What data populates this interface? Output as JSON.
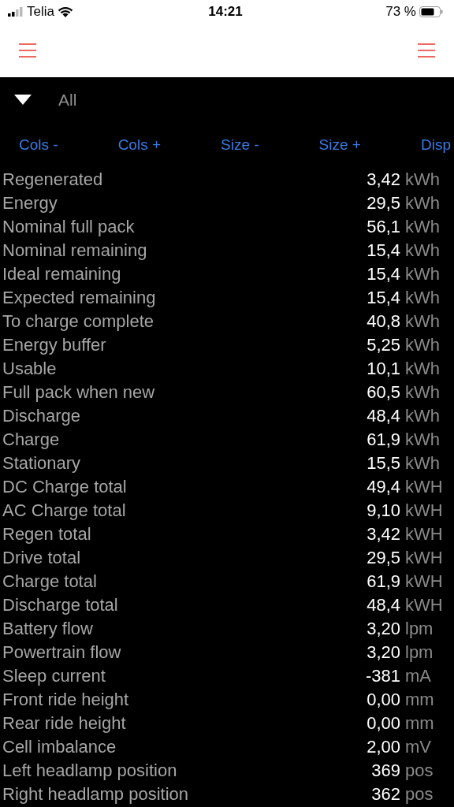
{
  "status_bar": {
    "carrier": "Telia",
    "time": "14:21",
    "battery": "73 %"
  },
  "filter": {
    "label": "All",
    "expanded": true
  },
  "toolbar": [
    "Cols -",
    "Cols +",
    "Size -",
    "Size +",
    "Disp"
  ],
  "rows": [
    {
      "label": "Regenerated",
      "value": "3,42",
      "unit": "kWh"
    },
    {
      "label": "Energy",
      "value": "29,5",
      "unit": "kWh"
    },
    {
      "label": "Nominal full pack",
      "value": "56,1",
      "unit": "kWh"
    },
    {
      "label": "Nominal remaining",
      "value": "15,4",
      "unit": "kWh"
    },
    {
      "label": "Ideal remaining",
      "value": "15,4",
      "unit": "kWh"
    },
    {
      "label": "Expected remaining",
      "value": "15,4",
      "unit": "kWh"
    },
    {
      "label": "To charge complete",
      "value": "40,8",
      "unit": "kWh"
    },
    {
      "label": "Energy buffer",
      "value": "5,25",
      "unit": "kWh"
    },
    {
      "label": "Usable",
      "value": "10,1",
      "unit": "kWh"
    },
    {
      "label": "Full pack when new",
      "value": "60,5",
      "unit": "kWh"
    },
    {
      "label": "Discharge",
      "value": "48,4",
      "unit": "kWh"
    },
    {
      "label": "Charge",
      "value": "61,9",
      "unit": "kWh"
    },
    {
      "label": "Stationary",
      "value": "15,5",
      "unit": "kWh"
    },
    {
      "label": "DC Charge total",
      "value": "49,4",
      "unit": "kWH"
    },
    {
      "label": "AC Charge total",
      "value": "9,10",
      "unit": "kWH"
    },
    {
      "label": "Regen total",
      "value": "3,42",
      "unit": "kWH"
    },
    {
      "label": "Drive total",
      "value": "29,5",
      "unit": "kWH"
    },
    {
      "label": "Charge total",
      "value": "61,9",
      "unit": "kWH"
    },
    {
      "label": "Discharge total",
      "value": "48,4",
      "unit": "kWH"
    },
    {
      "label": "Battery flow",
      "value": "3,20",
      "unit": "lpm"
    },
    {
      "label": "Powertrain flow",
      "value": "3,20",
      "unit": "lpm"
    },
    {
      "label": "Sleep current",
      "value": "-381",
      "unit": "mA"
    },
    {
      "label": "Front ride height",
      "value": "0,00",
      "unit": "mm"
    },
    {
      "label": "Rear ride height",
      "value": "0,00",
      "unit": "mm"
    },
    {
      "label": "Cell imbalance",
      "value": "2,00",
      "unit": "mV"
    },
    {
      "label": "Left headlamp position",
      "value": "369",
      "unit": "pos"
    },
    {
      "label": "Right headlamp position",
      "value": "362",
      "unit": "pos"
    }
  ]
}
